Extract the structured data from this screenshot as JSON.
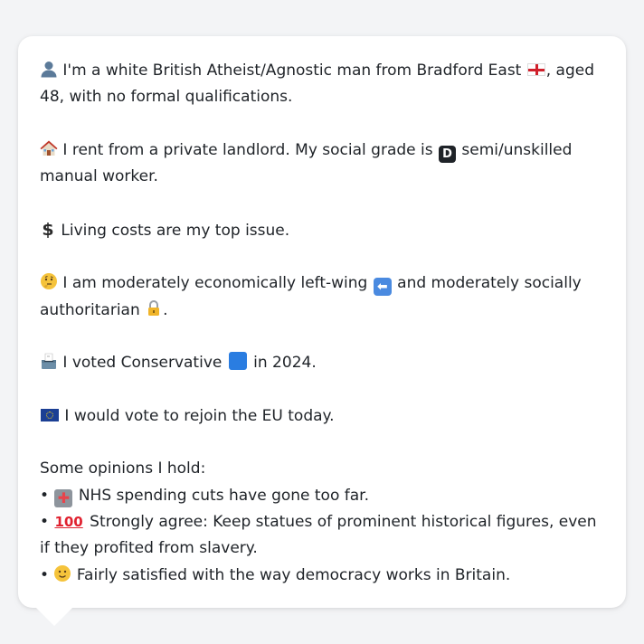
{
  "colors": {
    "background": "#f3f4f6",
    "bubble": "#ffffff",
    "text": "#1f2328",
    "conservative_blue": "#2a7de1"
  },
  "persona": {
    "p1": {
      "icon": "person-silhouette-icon",
      "text_a": "I'm a white British Atheist/Agnostic man from Bradford East",
      "flag_icon": "england-flag-icon",
      "text_b": ", aged 48, with no formal qualifications."
    },
    "p2": {
      "icon": "house-icon",
      "text_a": "I rent from a private landlord. My social grade is",
      "grade_letter": "D",
      "text_b": "semi/unskilled manual worker."
    },
    "p3": {
      "icon": "dollar-sign-icon",
      "glyph": "$",
      "text": "Living costs are my top issue."
    },
    "p4": {
      "icon": "thinking-face-icon",
      "text_a": "I am moderately economically left-wing",
      "left_arrow_icon": "left-arrow-icon",
      "text_b": "and moderately socially authoritarian",
      "lock_icon": "lock-icon",
      "text_c": "."
    },
    "p5": {
      "icon": "ballot-box-icon",
      "text_a": "I voted Conservative",
      "party_square_icon": "blue-square-icon",
      "text_b": "in 2024."
    },
    "p6": {
      "icon": "eu-flag-icon",
      "text": "I would vote to rejoin the EU today."
    },
    "opinions_heading": "Some opinions I hold:",
    "bullet": "•",
    "opinions": [
      {
        "icon": "hospital-icon",
        "text": "NHS spending cuts have gone too far."
      },
      {
        "icon": "hundred-points-icon",
        "glyph": "100",
        "text": "Strongly agree: Keep statues of prominent historical figures, even if they profited from slavery."
      },
      {
        "icon": "slightly-smiling-face-icon",
        "text": "Fairly satisfied with the way democracy works in Britain."
      }
    ]
  }
}
